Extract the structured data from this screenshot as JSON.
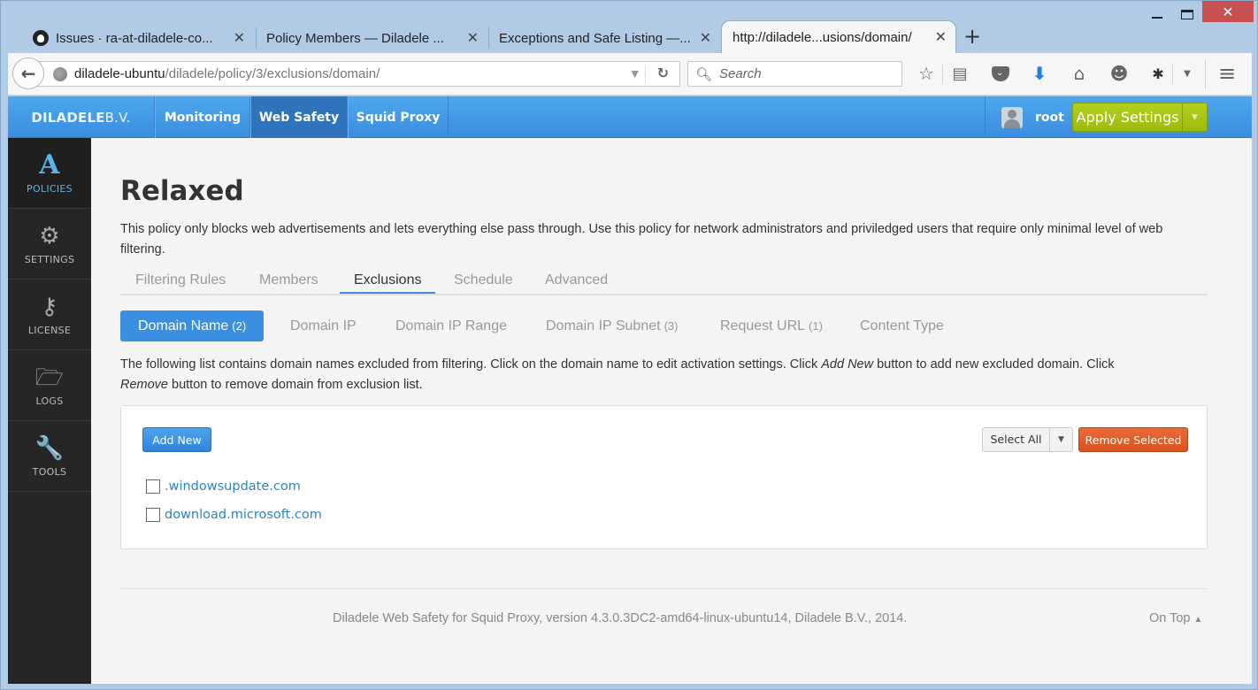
{
  "browser": {
    "tabs": [
      {
        "title": "Issues · ra-at-diladele-co...",
        "icon": "github-icon",
        "active": false
      },
      {
        "title": "Policy Members — Diladele ...",
        "active": false
      },
      {
        "title": "Exceptions and Safe Listing —...",
        "active": false
      },
      {
        "title": "http://diladele...usions/domain/",
        "active": true
      }
    ],
    "new_tab_label": "+",
    "close_glyph": "✕",
    "url_host": "diladele-ubuntu",
    "url_path": "/diladele/policy/3/exclusions/domain/",
    "search_placeholder": "Search",
    "toolbar_icons": [
      "bookmark-star-icon",
      "reading-list-icon",
      "pocket-icon",
      "downloads-icon",
      "home-icon",
      "chat-icon",
      "bug-extension-icon",
      "overflow-dropdown-icon",
      "hamburger-menu-icon"
    ]
  },
  "app": {
    "brand_bold": "DILADELE",
    "brand_light": " B.V.",
    "nav": [
      {
        "label": "Monitoring",
        "active": false
      },
      {
        "label": "Web Safety",
        "active": true
      },
      {
        "label": "Squid Proxy",
        "active": false
      }
    ],
    "user": "root",
    "apply_label": "Apply Settings",
    "sidebar": [
      {
        "label": "POLICIES",
        "icon": "policies-icon",
        "glyph": "A",
        "active": true
      },
      {
        "label": "SETTINGS",
        "icon": "gear-icon",
        "glyph": "⚙",
        "active": false
      },
      {
        "label": "LICENSE",
        "icon": "key-icon",
        "glyph": "⚷",
        "active": false
      },
      {
        "label": "LOGS",
        "icon": "folder-icon",
        "glyph": "🗁",
        "active": false
      },
      {
        "label": "TOOLS",
        "icon": "wrench-icon",
        "glyph": "🔧",
        "active": false
      }
    ]
  },
  "page": {
    "title": "Relaxed",
    "description": "This policy only blocks web advertisements and lets everything else pass through. Use this policy for network administrators and priviledged users that require only minimal level of web filtering.",
    "tabs": [
      {
        "label": "Filtering Rules",
        "active": false
      },
      {
        "label": "Members",
        "active": false
      },
      {
        "label": "Exclusions",
        "active": true
      },
      {
        "label": "Schedule",
        "active": false
      },
      {
        "label": "Advanced",
        "active": false
      }
    ],
    "pills": [
      {
        "label": "Domain Name",
        "count": "(2)",
        "active": true
      },
      {
        "label": "Domain IP",
        "count": "",
        "active": false
      },
      {
        "label": "Domain IP Range",
        "count": "",
        "active": false
      },
      {
        "label": "Domain IP Subnet",
        "count": "(3)",
        "active": false
      },
      {
        "label": "Request URL",
        "count": "(1)",
        "active": false
      },
      {
        "label": "Content Type",
        "count": "",
        "active": false
      }
    ],
    "list_desc": {
      "part1": "The following list contains domain names excluded from filtering. Click on the domain name to edit activation settings. Click ",
      "em1": "Add New",
      "part2": " button to add new excluded domain. Click ",
      "em2": "Remove",
      "part3": " button to remove domain from exclusion list."
    },
    "add_new_label": "Add New",
    "select_all_label": "Select All",
    "remove_selected_label": "Remove Selected",
    "domains": [
      {
        "name": ".windowsupdate.com",
        "checked": false
      },
      {
        "name": "download.microsoft.com",
        "checked": false
      }
    ],
    "footer": "Diladele Web Safety for Squid Proxy, version 4.3.0.3DC2-amd64-linux-ubuntu14, Diladele B.V., 2014.",
    "on_top_label": "On Top"
  },
  "colors": {
    "accent": "#3a8fe3",
    "apply_green": "#a8c516",
    "remove_orange": "#e0602a",
    "link": "#2b84c6",
    "sidebar_bg": "#262626",
    "sidebar_active": "#5ab4ec"
  }
}
